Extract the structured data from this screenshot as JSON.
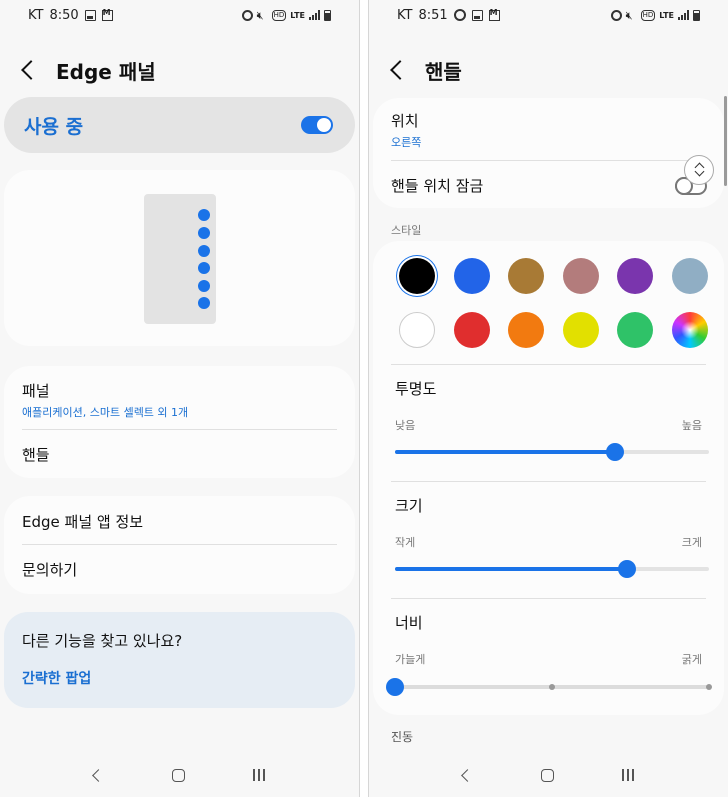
{
  "left": {
    "status": {
      "carrier": "KT",
      "time": "8:50",
      "hd": "HD",
      "lte": "LTE"
    },
    "appbar": {
      "title": "Edge 패널"
    },
    "master_switch": {
      "label": "사용 중",
      "enabled": true
    },
    "menu": {
      "panels_title": "패널",
      "panels_sub": "애플리케이션, 스마트 셀렉트 외 1개",
      "handle_title": "핸들"
    },
    "about": {
      "about_title": "Edge 패널 앱 정보",
      "contact_title": "문의하기"
    },
    "suggest": {
      "question": "다른 기능을 찾고 있나요?",
      "link": "간략한 팝업"
    }
  },
  "right": {
    "status": {
      "carrier": "KT",
      "time": "8:51",
      "hd": "HD",
      "lte": "LTE"
    },
    "appbar": {
      "title": "핸들"
    },
    "position": {
      "title": "위치",
      "value": "오른쪽"
    },
    "lock": {
      "title": "핸들 위치 잠금",
      "enabled": false
    },
    "style": {
      "label": "스타일",
      "colors": [
        "#000000",
        "#2264e8",
        "#a87a35",
        "#b37c7c",
        "#7a35ad",
        "#90aec4",
        "#ffffff",
        "#e02e2e",
        "#f27a10",
        "#e2e000",
        "#2fc268",
        "rainbow"
      ],
      "selected_index": 0
    },
    "transparency": {
      "title": "투명도",
      "low": "낮음",
      "high": "높음",
      "value": 0.7
    },
    "size": {
      "title": "크기",
      "low": "작게",
      "high": "크게",
      "value": 0.74
    },
    "width": {
      "title": "너비",
      "low": "가늘게",
      "high": "굵게",
      "value": 0.0,
      "steps": 3
    },
    "next_section": {
      "title": "진동"
    }
  },
  "colors": {
    "accent": "#1a73e8",
    "link": "#1a6fd1"
  }
}
